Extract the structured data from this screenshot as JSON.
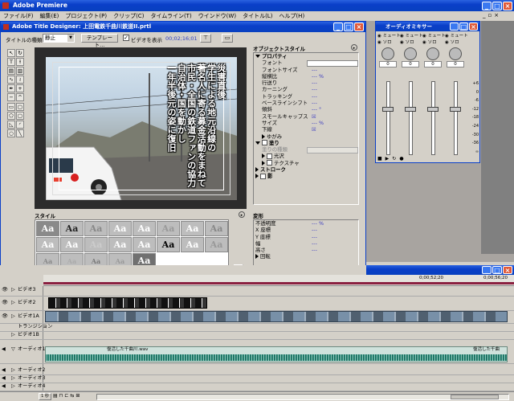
{
  "app": {
    "title": "Adobe Premiere",
    "menu": [
      "ファイル(F)",
      "編集(E)",
      "プロジェクト(P)",
      "クリップ(C)",
      "タイムライン(T)",
      "ウインドウ(W)",
      "タイトル(L)",
      "ヘルプ(H)"
    ]
  },
  "title_designer": {
    "window_title": "Adobe Title Designer: 上田電鉄千曲川鉄道II.prtl",
    "title_type_label": "タイトルの種類",
    "title_type_value": "静止",
    "template_button": "テンプレート...",
    "show_video_label": "ビデオを表示",
    "timecode": "00;02;16;01",
    "video_text_lines": [
      "災害直後",
      "学生による地元沿線の",
      "著名人に寄る募金活動をまねて",
      "市民・全国の鉄道ファンの協力",
      "自治体・国を動かし",
      "一年半後元の姿に復旧"
    ],
    "styles_header": "スタイル",
    "style_swatch_text": "Aa",
    "object_style_header": "オブジェクトスタイル",
    "properties": {
      "group": "プロパティ",
      "font_label": "フォント",
      "rows": [
        {
          "label": "フォントサイズ",
          "value": "---"
        },
        {
          "label": "縦横比",
          "value": "--- %"
        },
        {
          "label": "行送り",
          "value": "---"
        },
        {
          "label": "カーニング",
          "value": "---"
        },
        {
          "label": "トラッキング",
          "value": "---"
        },
        {
          "label": "ベースラインシフト",
          "value": "---"
        },
        {
          "label": "傾斜",
          "value": "--- °"
        },
        {
          "label": "スモールキャップス",
          "value": "☒"
        },
        {
          "label": "サイズ",
          "value": "--- %"
        },
        {
          "label": "下線",
          "value": "☒"
        }
      ],
      "distort_label": "ゆがみ"
    },
    "fill": {
      "group": "塗り",
      "fill_type_label": "塗りの種類",
      "gloss_label": "光沢",
      "texture_label": "テクスチャ"
    },
    "stroke_label": "ストローク",
    "shadow_label": "影",
    "transform": {
      "header": "変形",
      "rows": [
        {
          "label": "不透明度",
          "value": "--- %"
        },
        {
          "label": "X 座標",
          "value": "---"
        },
        {
          "label": "Y 座標",
          "value": "---"
        },
        {
          "label": "幅",
          "value": "---"
        },
        {
          "label": "高さ",
          "value": "---"
        }
      ],
      "rotation_label": "回転"
    }
  },
  "audio_mixer": {
    "title": "オーディオミキサー",
    "mute_label": "ミュート",
    "solo_label": "ソロ",
    "pan_value": "0",
    "db_scale": [
      "+6",
      "0",
      "-6",
      "-12",
      "-18",
      "-24",
      "-30",
      "-36",
      "∞"
    ],
    "channel_count": 4
  },
  "timeline": {
    "ruler": [
      "0;00;52;20",
      "0;00;56;20"
    ],
    "tracks": [
      {
        "label": "ビデオ3",
        "kind": "video"
      },
      {
        "label": "ビデオ2",
        "kind": "video"
      },
      {
        "label": "ビデオ1A",
        "kind": "video"
      },
      {
        "label": "トランジション",
        "kind": "transition"
      },
      {
        "label": "ビデオ1B",
        "kind": "video"
      },
      {
        "label": "オーディオ1",
        "kind": "audio"
      },
      {
        "label": "オーディオ2",
        "kind": "audio"
      },
      {
        "label": "オーディオ3",
        "kind": "audio"
      },
      {
        "label": "オーディオ4",
        "kind": "audio"
      }
    ],
    "audio_clip_left": "復活した千曲川.wav",
    "audio_clip_right": "復活した千曲",
    "footer_zoom": "1 秒"
  },
  "colors": {
    "accent": "#0a3fc8",
    "close": "#e05a3a",
    "ruler_mark": "#8a2040"
  }
}
